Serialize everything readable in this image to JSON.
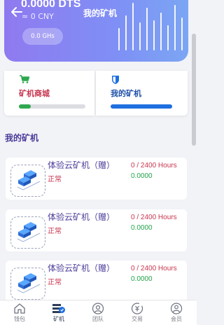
{
  "header": {
    "balance": "0.0000 DTS",
    "cny": "≈ 0 CNY",
    "title": "我的矿机",
    "hashrate": "0.0 GHs",
    "bar_levels": [
      0.45,
      0.7,
      0.95,
      0.55,
      0.85,
      0.6,
      0.75,
      0.5,
      0.9,
      0.65
    ]
  },
  "cards": [
    {
      "label": "矿机商城",
      "icon": "cart-icon",
      "color": "#c7344e",
      "accent": "#2fa84f",
      "progress": 0.18
    },
    {
      "label": "我的矿机",
      "icon": "shield-icon",
      "color": "#1d4fa8",
      "accent": "#1e6fe0",
      "progress": 1.0
    }
  ],
  "section_title": "我的矿机",
  "miners": [
    {
      "name": "体验云矿机（赠）",
      "status": "正常",
      "hours": "0 / 2400 Hours",
      "earnings": "0.0000"
    },
    {
      "name": "体验云矿机（赠）",
      "status": "正常",
      "hours": "0 / 2400 Hours",
      "earnings": "0.0000"
    },
    {
      "name": "体验云矿机（赠）",
      "status": "正常",
      "hours": "0 / 2400 Hours",
      "earnings": "0.0000"
    }
  ],
  "tabs": [
    {
      "label": "钱包",
      "icon": "home-icon",
      "active": false
    },
    {
      "label": "矿机",
      "icon": "miner-icon",
      "active": true
    },
    {
      "label": "团队",
      "icon": "team-icon",
      "active": false
    },
    {
      "label": "交易",
      "icon": "trade-icon",
      "active": false
    },
    {
      "label": "会员",
      "icon": "member-icon",
      "active": false
    }
  ],
  "colors": {
    "primary_text": "#4b3f9a",
    "status_red": "#c7344e",
    "earn_green": "#21a64b"
  }
}
